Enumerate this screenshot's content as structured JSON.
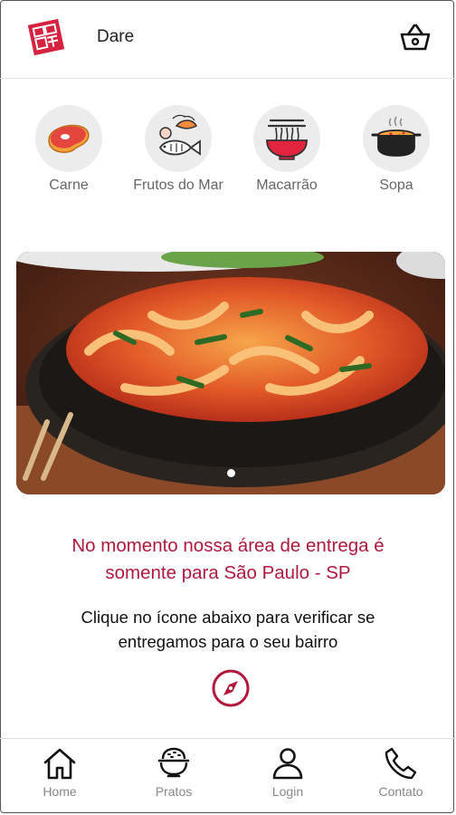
{
  "header": {
    "app_name": "Dare"
  },
  "categories": [
    {
      "label": "Carne",
      "icon": "steak-icon"
    },
    {
      "label": "Frutos do Mar",
      "icon": "seafood-icon"
    },
    {
      "label": "Macarrão",
      "icon": "noodles-bowl-icon"
    },
    {
      "label": "Sopa",
      "icon": "soup-pot-icon"
    }
  ],
  "banner": {
    "slide_count": 1,
    "active_slide": 1
  },
  "notice": {
    "line1": "No momento nossa área de entrega é",
    "line2": "somente para São Paulo - SP"
  },
  "hint": {
    "line1": "Clique no ícone abaixo para verificar se",
    "line2": "entregamos para o seu bairro"
  },
  "bottom_nav": [
    {
      "label": "Home",
      "icon": "home-icon"
    },
    {
      "label": "Pratos",
      "icon": "dish-icon"
    },
    {
      "label": "Login",
      "icon": "user-icon"
    },
    {
      "label": "Contato",
      "icon": "phone-icon"
    }
  ],
  "colors": {
    "accent": "#b0183c",
    "logo_red": "#d6213f"
  }
}
